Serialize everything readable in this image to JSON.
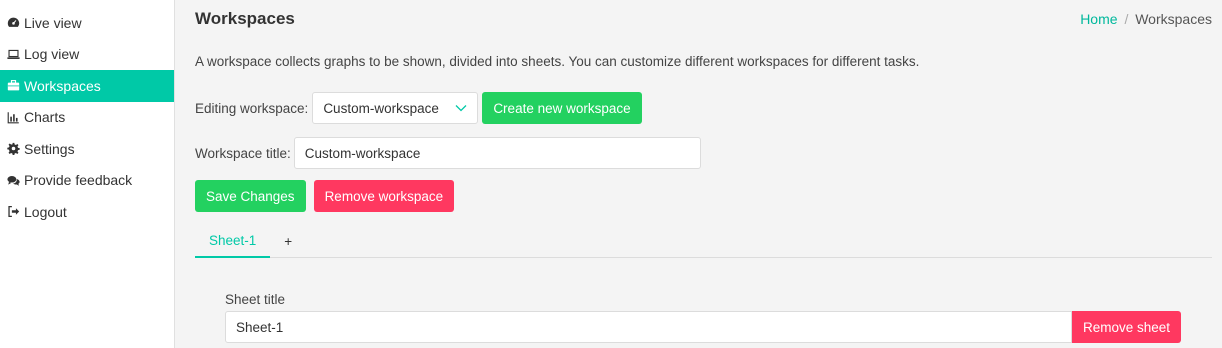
{
  "sidebar": {
    "items": [
      {
        "label": "Live view",
        "icon": "dashboard-icon",
        "active": false
      },
      {
        "label": "Log view",
        "icon": "laptop-icon",
        "active": false
      },
      {
        "label": "Workspaces",
        "icon": "briefcase-icon",
        "active": true
      },
      {
        "label": "Charts",
        "icon": "bar-chart-icon",
        "active": false
      },
      {
        "label": "Settings",
        "icon": "gear-icon",
        "active": false
      },
      {
        "label": "Provide feedback",
        "icon": "comments-icon",
        "active": false
      },
      {
        "label": "Logout",
        "icon": "sign-out-icon",
        "active": false
      }
    ]
  },
  "header": {
    "title": "Workspaces",
    "breadcrumb": {
      "home": "Home",
      "separator": "/",
      "current": "Workspaces"
    }
  },
  "description": "A workspace collects graphs to be shown, divided into sheets. You can customize different workspaces for different tasks.",
  "editing": {
    "label": "Editing workspace:",
    "selected": "Custom-workspace",
    "create_button": "Create new workspace"
  },
  "workspace_title": {
    "label": "Workspace title:",
    "value": "Custom-workspace"
  },
  "actions": {
    "save": "Save Changes",
    "remove": "Remove workspace"
  },
  "tabs": [
    {
      "label": "Sheet-1",
      "active": true
    },
    {
      "label": "+",
      "active": false
    }
  ],
  "sheet": {
    "title_label": "Sheet title",
    "title_value": "Sheet-1",
    "remove_button": "Remove sheet"
  },
  "colors": {
    "accent": "#00c9a7",
    "success": "#23d160",
    "danger": "#ff3860"
  }
}
